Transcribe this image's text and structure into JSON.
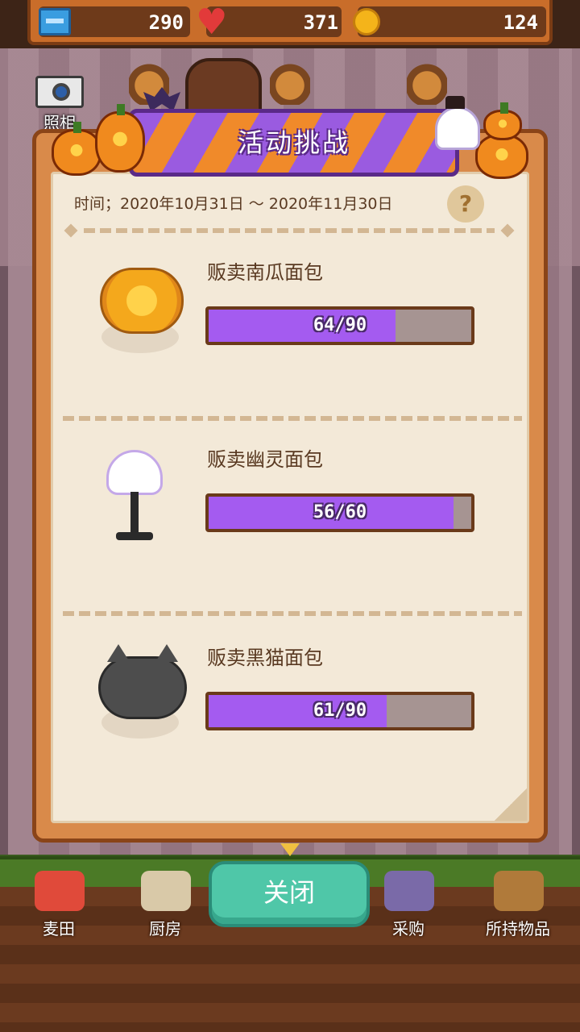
{
  "resources": {
    "tickets": "290",
    "hearts": "371",
    "coins": "124"
  },
  "camera": {
    "label": "照相"
  },
  "dialog": {
    "title": "活动挑战",
    "date_range": "时间；2020年10月31日 ～ 2020年11月30日",
    "help": "?",
    "challenges": [
      {
        "name": "贩卖南瓜面包",
        "progress_text": "64/90",
        "current": 64,
        "goal": 90,
        "icon": "pumpkin-bread-icon"
      },
      {
        "name": "贩卖幽灵面包",
        "progress_text": "56/60",
        "current": 56,
        "goal": 60,
        "icon": "ghost-bread-icon"
      },
      {
        "name": "贩卖黑猫面包",
        "progress_text": "61/90",
        "current": 61,
        "goal": 90,
        "icon": "black-cat-bread-icon"
      }
    ]
  },
  "close_button": {
    "label": "关闭"
  },
  "nav": {
    "items": [
      {
        "label": "麦田",
        "icon": "wheat-field-icon"
      },
      {
        "label": "厨房",
        "icon": "kitchen-icon"
      },
      {
        "label": "采购",
        "icon": "purchase-icon"
      },
      {
        "label": "所持物品",
        "icon": "inventory-box-icon"
      }
    ]
  },
  "colors": {
    "progress_fill": "#a45bf0",
    "close_button": "#4fc7a8",
    "panel_frame": "#d98a4a",
    "banner_purple": "#9a5be0",
    "banner_orange": "#f08a2a"
  }
}
